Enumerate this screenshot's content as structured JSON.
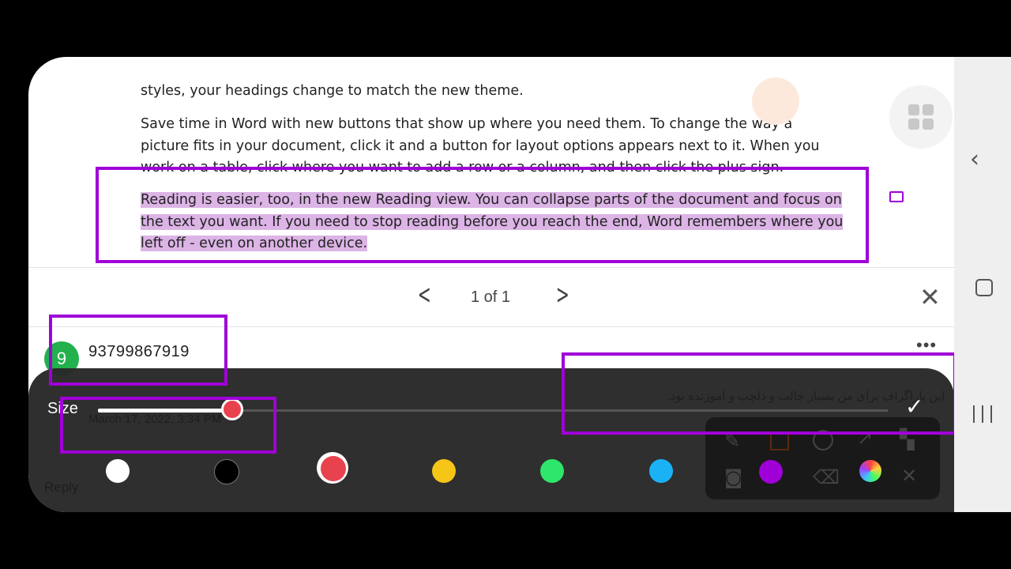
{
  "document": {
    "para1": "styles, your headings change to match the new theme.",
    "para2": "Save time in Word with new buttons that show up where you need them. To change the way a picture fits in your document, click it and a button for layout options appears next to it. When you work on a table, click where you want to add a row or a column, and then click the plus sign.",
    "para3_line1": "Reading is easier, too, in the new Reading view. You can collapse parts of the document and focus on",
    "para3_line2": "the text you want. If you need to stop reading before you reach the end, Word remembers where you",
    "para3_line3": "left off - even on another device."
  },
  "comments_pager": {
    "count": "1 of 1"
  },
  "comment": {
    "avatar_initial": "9",
    "author": "93799867919",
    "date": "March 17, 2022, 3:34 PM",
    "body": "این پاراگراف برای من بسیار جالب و دلچب و اموزنده بود.",
    "reply": "Reply"
  },
  "draw_panel": {
    "size_label": "Size",
    "size_value": 0.17,
    "pen_colors": [
      "#ffffff",
      "#000000",
      "#e8424e",
      "#f5c518",
      "#2ee66b",
      "#1ab2f5"
    ],
    "selected_color": "#e8424e",
    "annotation_color": "#a000d8"
  },
  "icons": [
    "chevron-left-icon",
    "chevron-right-icon",
    "close-icon",
    "more-icon",
    "check-icon",
    "comment-icon",
    "grid-icon",
    "brush-icon",
    "square-icon",
    "circle-icon",
    "arrow-icon",
    "mosaic-icon",
    "camera-icon",
    "eraser-icon",
    "color-wheel-icon",
    "undo-icon",
    "nav-back-icon",
    "nav-home-icon",
    "nav-recents-icon"
  ]
}
